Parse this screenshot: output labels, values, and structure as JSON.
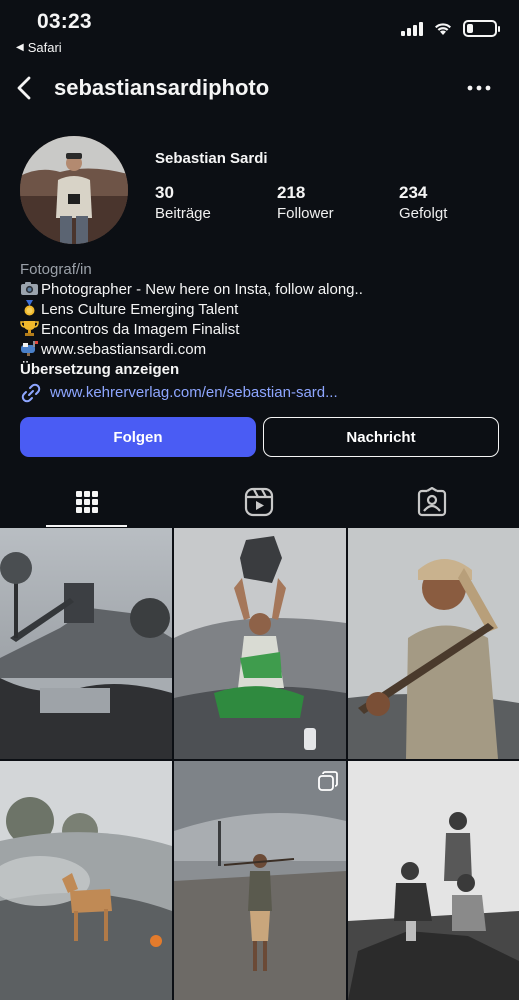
{
  "status_bar": {
    "time": "03:23",
    "back_app": "Safari"
  },
  "header": {
    "username": "sebastiansardiphoto"
  },
  "profile": {
    "display_name": "Sebastian Sardi",
    "stats": [
      {
        "value": "30",
        "label": "Beiträge"
      },
      {
        "value": "218",
        "label": "Follower"
      },
      {
        "value": "234",
        "label": "Gefolgt"
      }
    ],
    "category": "Fotograf/in",
    "bio_lines": [
      {
        "icon": "camera-emoji",
        "text": "Photographer - New here on Insta, follow along.."
      },
      {
        "icon": "medal-emoji",
        "text": "Lens Culture Emerging Talent"
      },
      {
        "icon": "trophy-emoji",
        "text": "Encontros da Imagem Finalist"
      },
      {
        "icon": "mailbox-emoji",
        "text": "www.sebastiansardi.com"
      }
    ],
    "translate_label": "Übersetzung anzeigen",
    "external_link": "www.kehrerverlag.com/en/sebastian-sard..."
  },
  "actions": {
    "follow": "Folgen",
    "message": "Nachricht"
  },
  "tabs": [
    "grid-icon",
    "reels-icon",
    "tagged-icon"
  ],
  "colors": {
    "background": "#0c0f14",
    "accent": "#4a5cf4",
    "link": "#8ea6ff"
  },
  "grid": [
    {
      "name": "coal-mine-landscape-photo"
    },
    {
      "name": "woman-carrying-coal-photo"
    },
    {
      "name": "man-with-pickaxe-photo"
    },
    {
      "name": "dog-on-smoky-field-photo"
    },
    {
      "name": "man-on-road-photo",
      "multi": true
    },
    {
      "name": "group-of-men-bw-photo"
    }
  ]
}
